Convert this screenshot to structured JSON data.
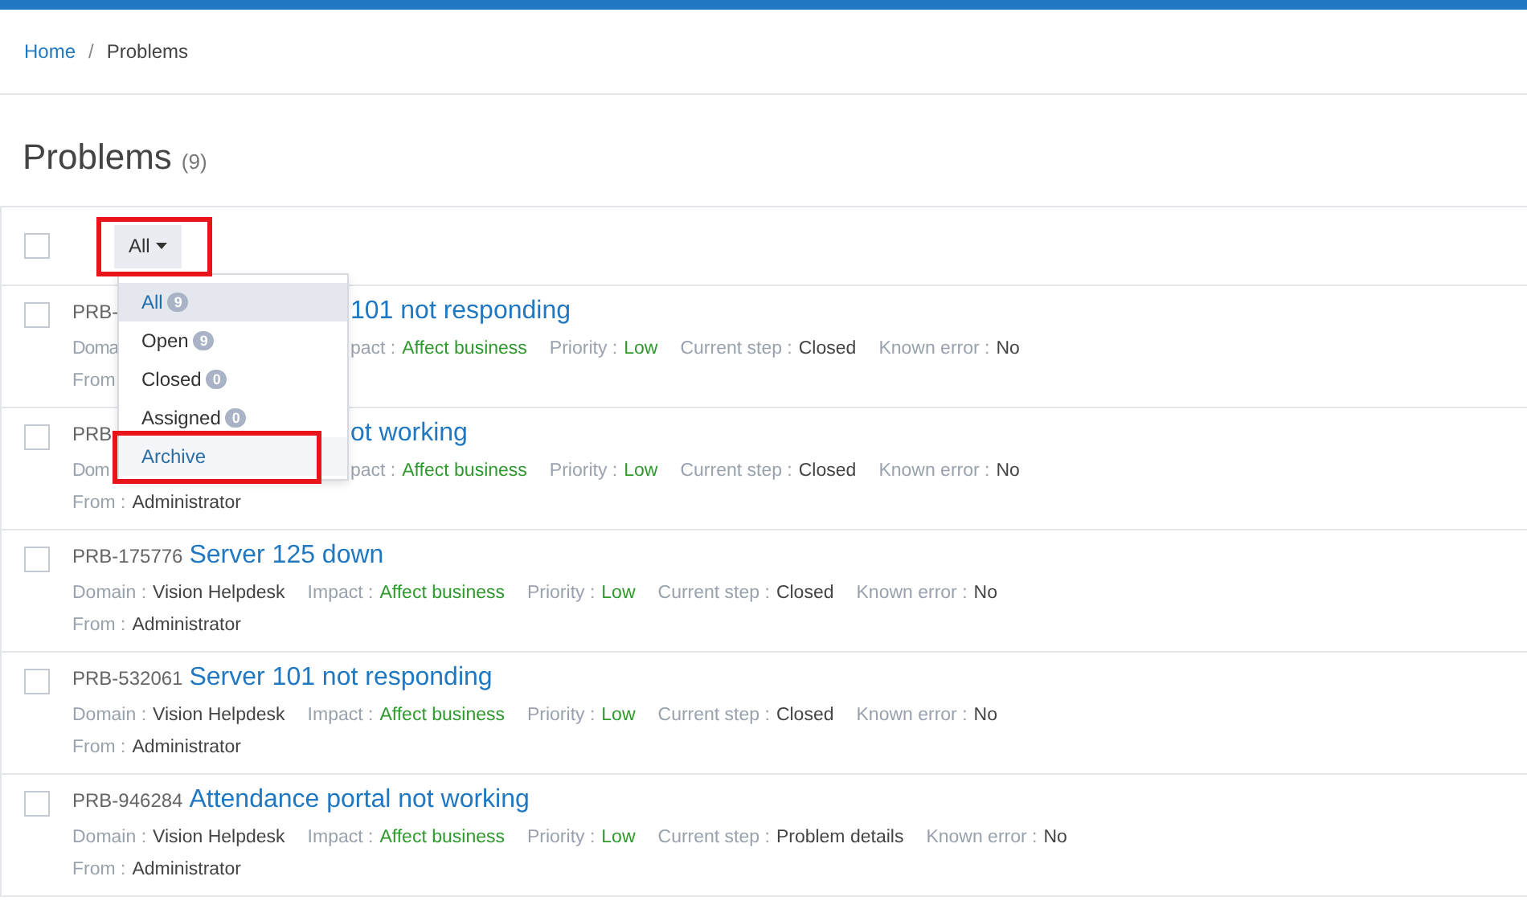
{
  "breadcrumb": {
    "items": [
      {
        "label": "Home",
        "link": true
      },
      {
        "label": "Problems",
        "link": false
      }
    ],
    "separator": "/"
  },
  "page": {
    "title": "Problems",
    "count": "(9)"
  },
  "select_all": {
    "checked": false
  },
  "filter": {
    "label": "All",
    "annotated": true,
    "menu": [
      {
        "label": "All",
        "badge": "9",
        "selected": true,
        "hovered": false,
        "annotated": false
      },
      {
        "label": "Open",
        "badge": "9",
        "selected": false,
        "hovered": false,
        "annotated": false
      },
      {
        "label": "Closed",
        "badge": "0",
        "selected": false,
        "hovered": false,
        "annotated": false
      },
      {
        "label": "Assigned",
        "badge": "0",
        "selected": false,
        "hovered": false,
        "annotated": false
      },
      {
        "label": "Archive",
        "selected": false,
        "hovered": true,
        "annotated": true
      }
    ]
  },
  "rows": [
    {
      "checked": false,
      "id": "PRB-",
      "title": "101 not responding",
      "meta_lead": "Doma",
      "meta": [
        {
          "label": "pact :",
          "value": "Affect business",
          "color": "#2e9a2e"
        },
        {
          "label": "Priority :",
          "value": "Low",
          "color": "#2e9a2e"
        },
        {
          "label": "Current step :",
          "value": "Closed",
          "color": "#444444"
        },
        {
          "label": "Known error :",
          "value": "No",
          "color": "#444444"
        }
      ],
      "from_label": "From"
    },
    {
      "checked": false,
      "id": "PRB",
      "title": "ot working",
      "meta_lead": "Dom",
      "meta": [
        {
          "label": "pact :",
          "value": "Affect business",
          "color": "#2e9a2e"
        },
        {
          "label": "Priority :",
          "value": "Low",
          "color": "#2e9a2e"
        },
        {
          "label": "Current step :",
          "value": "Closed",
          "color": "#444444"
        },
        {
          "label": "Known error :",
          "value": "No",
          "color": "#444444"
        }
      ],
      "from_label": "From :",
      "from_value": "Administrator"
    },
    {
      "checked": false,
      "id": "PRB-175776",
      "title": "Server 125 down",
      "meta": [
        {
          "label": "Domain :",
          "value": "Vision Helpdesk",
          "color": "#444444"
        },
        {
          "label": "Impact :",
          "value": "Affect business",
          "color": "#2e9a2e"
        },
        {
          "label": "Priority :",
          "value": "Low",
          "color": "#2e9a2e"
        },
        {
          "label": "Current step :",
          "value": "Closed",
          "color": "#444444"
        },
        {
          "label": "Known error :",
          "value": "No",
          "color": "#444444"
        }
      ],
      "from_label": "From :",
      "from_value": "Administrator"
    },
    {
      "checked": false,
      "id": "PRB-532061",
      "title": "Server 101 not responding",
      "meta": [
        {
          "label": "Domain :",
          "value": "Vision Helpdesk",
          "color": "#444444"
        },
        {
          "label": "Impact :",
          "value": "Affect business",
          "color": "#2e9a2e"
        },
        {
          "label": "Priority :",
          "value": "Low",
          "color": "#2e9a2e"
        },
        {
          "label": "Current step :",
          "value": "Closed",
          "color": "#444444"
        },
        {
          "label": "Known error :",
          "value": "No",
          "color": "#444444"
        }
      ],
      "from_label": "From :",
      "from_value": "Administrator"
    },
    {
      "checked": false,
      "id": "PRB-946284",
      "title": "Attendance portal not working",
      "meta": [
        {
          "label": "Domain :",
          "value": "Vision Helpdesk",
          "color": "#444444"
        },
        {
          "label": "Impact :",
          "value": "Affect business",
          "color": "#2e9a2e"
        },
        {
          "label": "Priority :",
          "value": "Low",
          "color": "#2e9a2e"
        },
        {
          "label": "Current step :",
          "value": "Problem details",
          "color": "#444444"
        },
        {
          "label": "Known error :",
          "value": "No",
          "color": "#444444"
        }
      ],
      "from_label": "From :",
      "from_value": "Administrator"
    }
  ]
}
